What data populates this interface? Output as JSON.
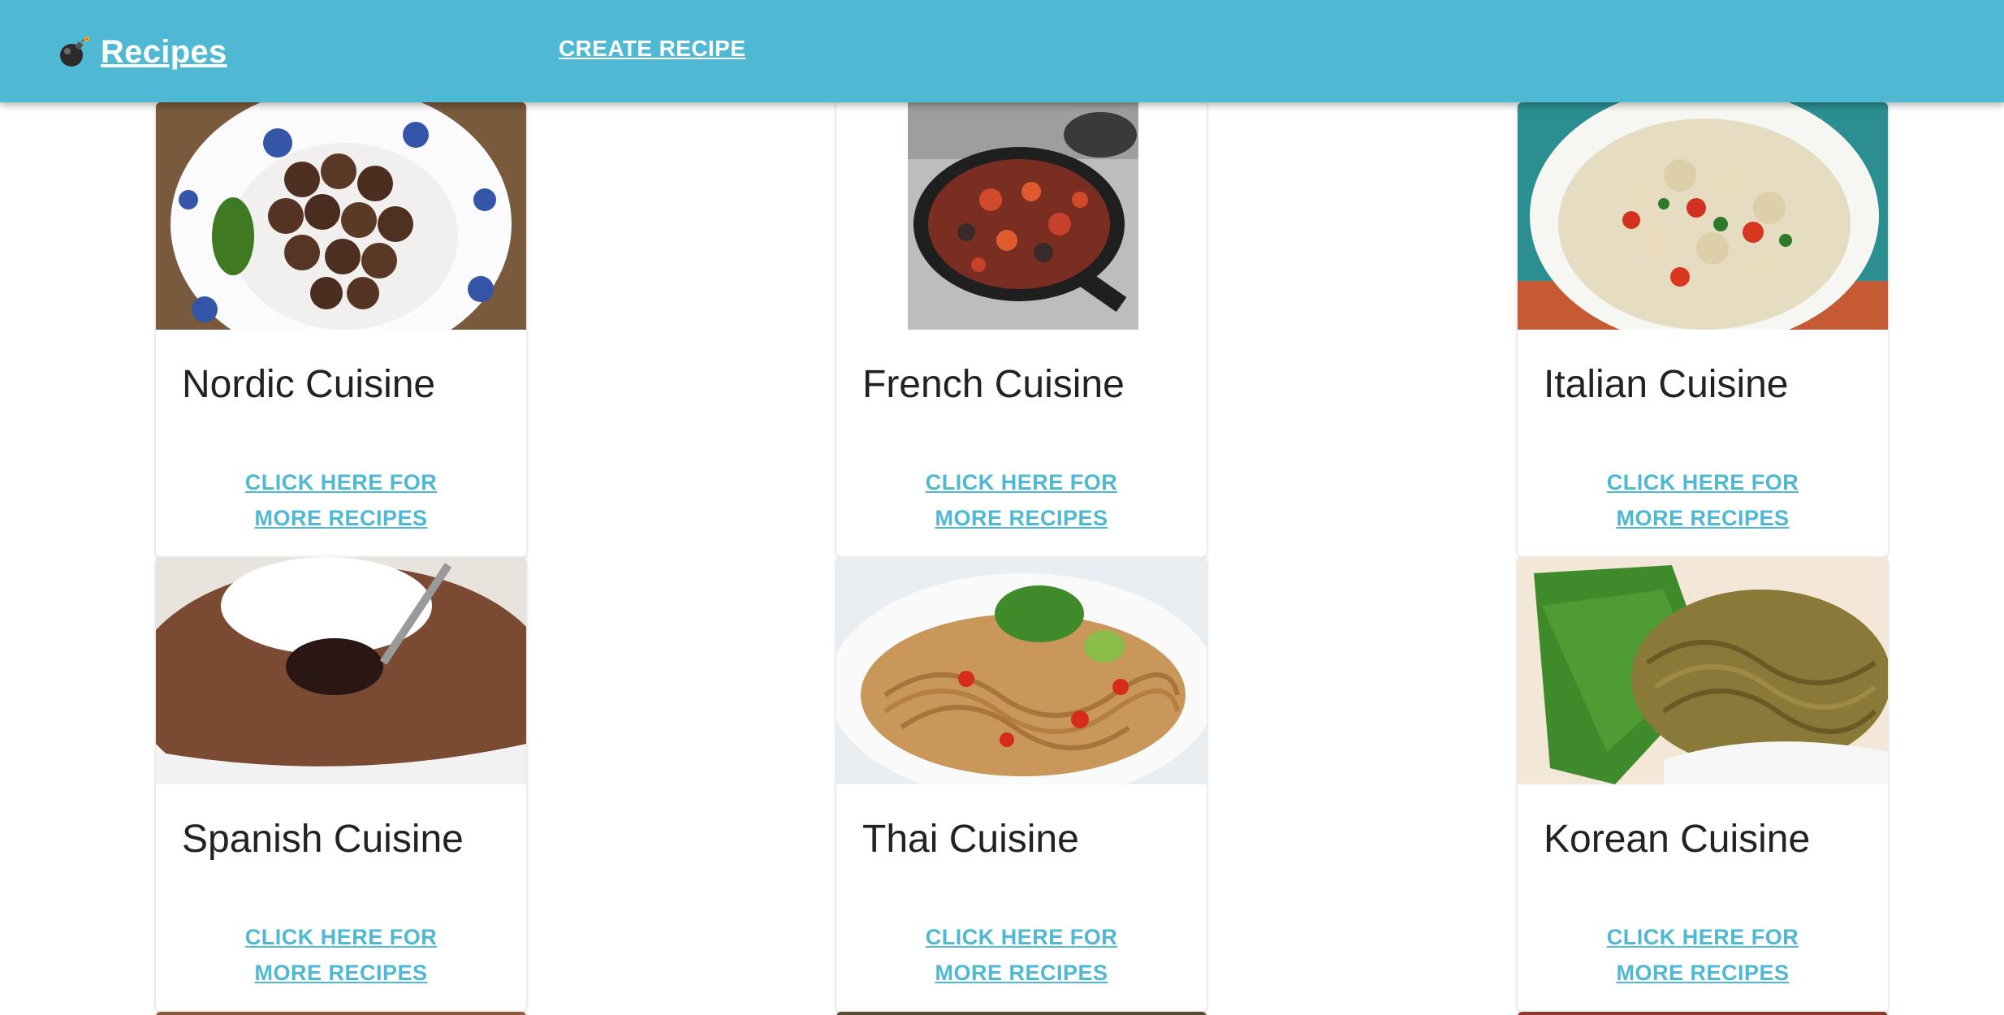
{
  "header": {
    "brand_icon": "bomb-icon",
    "brand_label": "Recipes",
    "create_label": "CREATE RECIPE",
    "background": "#4fb8d2"
  },
  "cards": [
    {
      "title": "Nordic Cuisine",
      "link": "CLICK HERE FOR MORE RECIPES",
      "image": "meatballs-plate-image"
    },
    {
      "title": "French Cuisine",
      "link": "CLICK HERE FOR MORE RECIPES",
      "image": "ratatouille-skillet-image"
    },
    {
      "title": "Italian Cuisine",
      "link": "CLICK HERE FOR MORE RECIPES",
      "image": "pasta-salad-bowl-image"
    },
    {
      "title": "Spanish Cuisine",
      "link": "CLICK HERE FOR MORE RECIPES",
      "image": "chocolate-souffle-image"
    },
    {
      "title": "Thai Cuisine",
      "link": "CLICK HERE FOR MORE RECIPES",
      "image": "noodle-salad-bowl-image"
    },
    {
      "title": "Korean Cuisine",
      "link": "CLICK HERE FOR MORE RECIPES",
      "image": "noodles-leaf-bowl-image"
    }
  ],
  "colors": {
    "accent": "#4fb8d2",
    "title_text": "#222222",
    "card_bg": "#ffffff"
  }
}
